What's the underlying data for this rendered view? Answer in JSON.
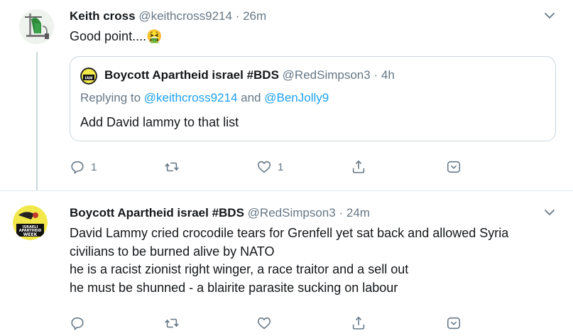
{
  "tweets": [
    {
      "name": "Keith cross",
      "handle": "@keithcross9214",
      "sep": "·",
      "time": "26m",
      "text": "Good point....",
      "emoji": "🤮",
      "avatar_icon": "lab-equipment-avatar",
      "quote": {
        "name": "Boycott Apartheid israel #BDS",
        "handle": "@RedSimpson3",
        "sep": "·",
        "time": "4h",
        "reply_prefix": "Replying to",
        "reply_mention1": "@keithcross9214",
        "reply_and": "and",
        "reply_mention2": "@BenJolly9",
        "text": "Add David lammy to that list"
      },
      "actions": {
        "reply_count": "1",
        "retweet_count": "",
        "like_count": "1"
      }
    },
    {
      "name": "Boycott Apartheid israel #BDS",
      "handle": "@RedSimpson3",
      "sep": "·",
      "time": "24m",
      "avatar_icon": "israeli-apartheid-week-avatar",
      "lines": [
        "David Lammy cried crocodile tears for Grenfell yet sat back and allowed Syria",
        "civilians to be burned alive by NATO",
        "he is a racist zionist right winger, a race traitor and a sell out",
        "he must be shunned - a blairite parasite sucking on labour"
      ],
      "actions": {
        "reply_count": "",
        "retweet_count": "",
        "like_count": ""
      }
    }
  ],
  "colors": {
    "text": "#14171a",
    "muted": "#657786",
    "link": "#1da1f2",
    "border": "#ccd6dd"
  }
}
